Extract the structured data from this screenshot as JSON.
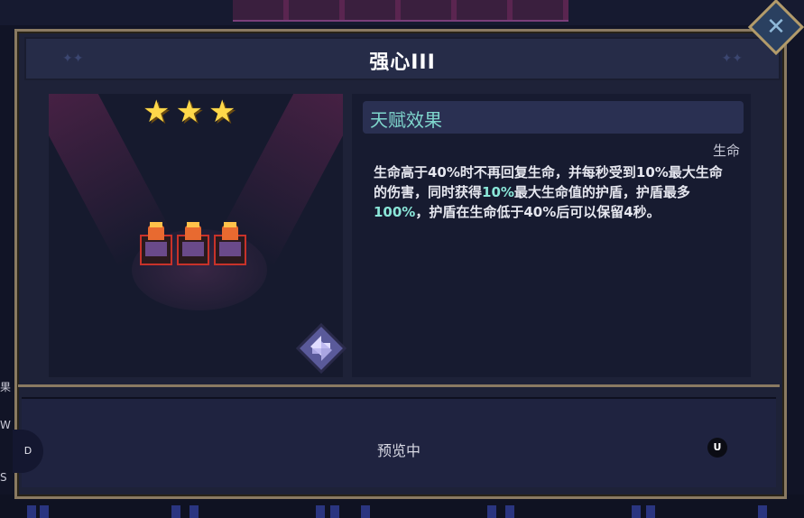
{
  "dialog": {
    "title": "强心III",
    "stars": [
      "★",
      "★",
      "★"
    ],
    "star_rating": 3,
    "star_max": 3,
    "star_color": "#ffd84a"
  },
  "talent": {
    "heading": "天赋效果",
    "category": "生命",
    "description": [
      {
        "text": "生命高于40%时不再回复生命，并每秒受到10%最大生命的伤害，同时获得",
        "hl": false
      },
      {
        "text": "10%",
        "hl": true
      },
      {
        "text": "最大生命值的护盾，护盾最多",
        "hl": false
      },
      {
        "text": "100%",
        "hl": true
      },
      {
        "text": "，护盾在生命低于40%后可以保留4秒。",
        "hl": false
      }
    ],
    "highlight_color": "#8ae6d8"
  },
  "footer": {
    "status_label": "预览中",
    "key_u": "U",
    "key_d": "D"
  },
  "side": {
    "left_chars": [
      "W",
      "S"
    ],
    "left_fragment": "果"
  },
  "icons": {
    "corner": "close-icon",
    "swap": "swap-icon",
    "unit": "fire-demon-unit-icon"
  }
}
